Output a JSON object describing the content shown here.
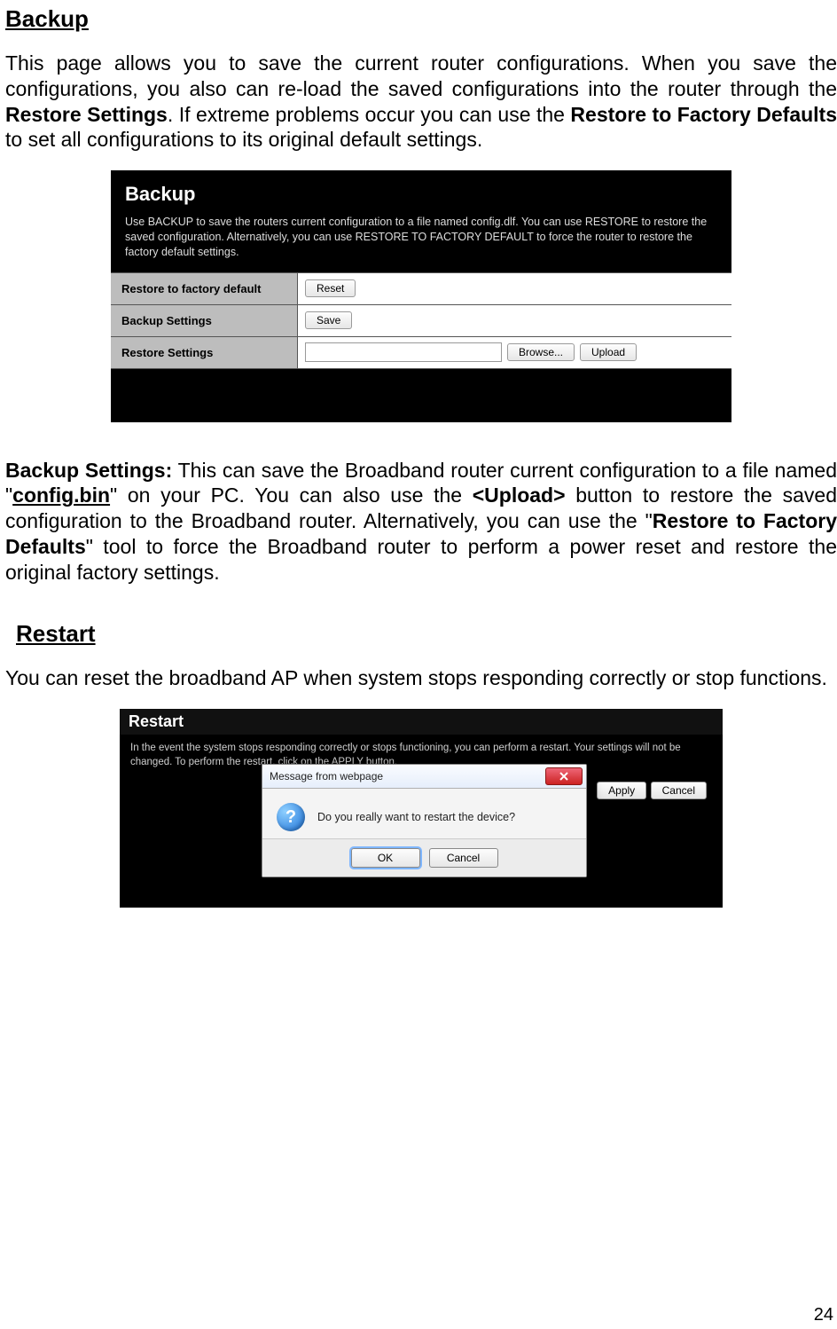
{
  "backup": {
    "heading": "Backup",
    "intro_parts": {
      "p1": "This page allows you to save the current router configurations. When you save the configurations, you also can re-load the saved configurations into the router through the ",
      "restore_settings_b": "Restore Settings",
      "p2": ". If extreme problems occur you can use the ",
      "restore_factory_b": "Restore to Factory Defaults",
      "p3": " to set all configurations to its original default settings."
    },
    "panel": {
      "title": "Backup",
      "desc": "Use BACKUP to save the routers current configuration to a file named config.dlf. You can use RESTORE to restore the saved configuration. Alternatively, you can use RESTORE TO FACTORY DEFAULT to force the router to restore the factory default settings.",
      "rows": {
        "factory_label": "Restore to factory default",
        "factory_btn": "Reset",
        "backup_label": "Backup Settings",
        "backup_btn": "Save",
        "restore_label": "Restore Settings",
        "browse_btn": "Browse...",
        "upload_btn": "Upload"
      }
    },
    "settings_para": {
      "lead_b": "Backup Settings:",
      "p1": " This can save the Broadband router current configuration to a file named \"",
      "configbin": "config.bin",
      "p2": "\" on your PC. You can also use the ",
      "upload_b": "<Upload>",
      "p3": " button to restore the saved configuration to the Broadband router. Alternatively, you can use the \"",
      "rfd_b": "Restore to Factory Defaults",
      "p4": "\" tool to force the Broadband router to perform a power reset and restore the original factory settings."
    }
  },
  "restart": {
    "heading": "Restart",
    "intro": "You can reset the broadband AP when system stops responding correctly or stop functions.",
    "panel": {
      "title": "Restart",
      "desc": "In the event the system stops responding correctly or stops functioning, you can perform a restart. Your settings will not be changed. To perform the restart, click on the APPLY button.",
      "apply_btn": "Apply",
      "cancel_btn": "Cancel"
    },
    "dialog": {
      "titlebar": "Message from webpage",
      "message": "Do you really want to restart the device?",
      "ok_btn": "OK",
      "cancel_btn": "Cancel"
    }
  },
  "page_number": "24"
}
